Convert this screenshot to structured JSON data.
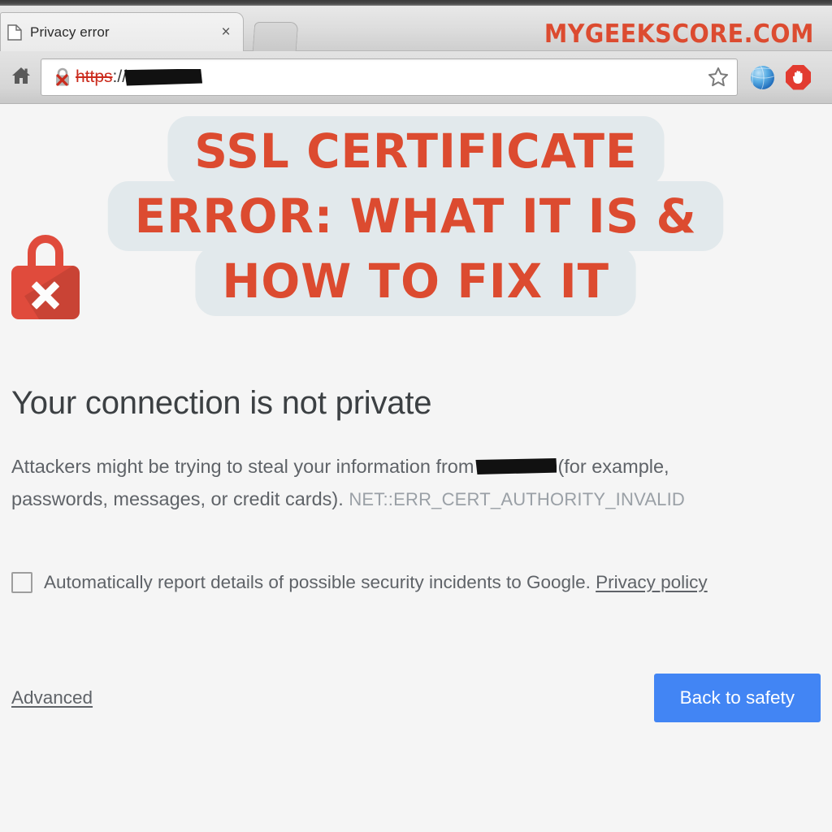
{
  "browser": {
    "tab": {
      "title": "Privacy error",
      "favicon": "page-icon",
      "close_label": "×"
    },
    "newtab_label": "",
    "watermark": "MYGEEKSCORE.COM",
    "toolbar": {
      "home_icon": "home-icon",
      "omnibox": {
        "security_icon": "broken-lock-icon",
        "scheme": "https",
        "separator": "://",
        "host_redacted": true,
        "bookmark_icon": "star-icon"
      },
      "extensions": [
        {
          "name": "globe-extension-icon",
          "label": ""
        },
        {
          "name": "adblock-stop-hand-icon",
          "label": ""
        }
      ]
    }
  },
  "overlay": {
    "lines": [
      "SSL CERTIFICATE",
      "ERROR: WHAT IT IS &",
      "HOW TO FIX IT"
    ],
    "text_color": "#dc4b30",
    "panel_color": "#e2e9ec"
  },
  "interstitial": {
    "icon": "red-padlock-error-icon",
    "heading": "Your connection is not private",
    "paragraph_before": "Attackers might be trying to steal your information from",
    "paragraph_after": "(for example, passwords, messages, or credit cards).",
    "error_code": "NET::ERR_CERT_AUTHORITY_INVALID",
    "report_checkbox": {
      "checked": false,
      "label": "Automatically report details of possible security incidents to Google.",
      "link": "Privacy policy"
    },
    "advanced_link": "Advanced",
    "primary_button": "Back to safety",
    "primary_button_color": "#4285f4"
  }
}
